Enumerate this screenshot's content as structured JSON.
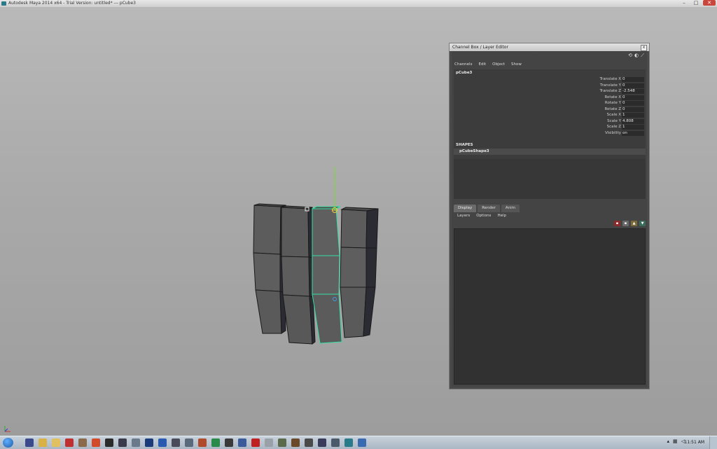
{
  "window": {
    "title": "Autodesk Maya 2014 x64 - Trial Version: untitled*  ---  pCube3",
    "min_label": "–",
    "max_label": "□",
    "close_label": "✕"
  },
  "channel_box": {
    "title": "Channel Box / Layer Editor",
    "close_label": "x",
    "menu": [
      "Channels",
      "Edit",
      "Object",
      "Show"
    ],
    "node": "pCube3",
    "attributes": [
      {
        "label": "Translate X",
        "value": "0"
      },
      {
        "label": "Translate Y",
        "value": "0"
      },
      {
        "label": "Translate Z",
        "value": "-2.548"
      },
      {
        "label": "Rotate X",
        "value": "0"
      },
      {
        "label": "Rotate Y",
        "value": "0"
      },
      {
        "label": "Rotate Z",
        "value": "0"
      },
      {
        "label": "Scale X",
        "value": "1"
      },
      {
        "label": "Scale Y",
        "value": "4.808"
      },
      {
        "label": "Scale Z",
        "value": "1"
      },
      {
        "label": "Visibility",
        "value": "on"
      }
    ],
    "shapes_heading": "SHAPES",
    "shape_name": "pCubeShape3"
  },
  "layer_editor": {
    "tabs": [
      "Display",
      "Render",
      "Anim"
    ],
    "active_tab": "Display",
    "menu": [
      "Layers",
      "Options",
      "Help"
    ]
  },
  "taskbar": {
    "clock": "11:51 AM"
  },
  "colors": {
    "selection_highlight": "#33e0a0",
    "panel_bg": "#444444",
    "viewport_top": "#b9b9b9",
    "viewport_bottom": "#9c9c9c"
  }
}
